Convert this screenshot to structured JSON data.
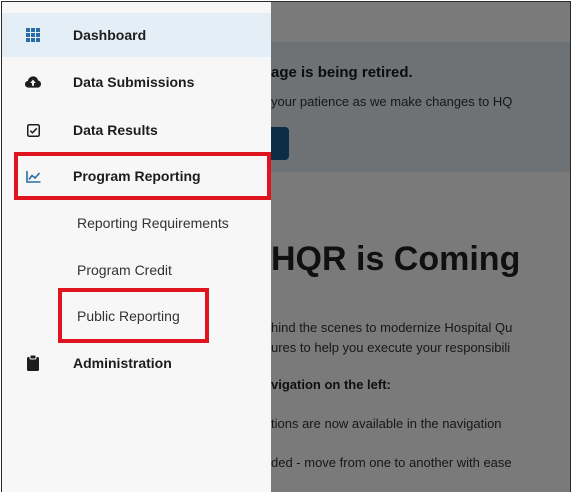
{
  "sidebar": {
    "items": [
      {
        "label": "Dashboard",
        "icon": "grid-icon"
      },
      {
        "label": "Data Submissions",
        "icon": "cloud-upload-icon"
      },
      {
        "label": "Data Results",
        "icon": "checkbox-icon"
      },
      {
        "label": "Program Reporting",
        "icon": "line-chart-icon"
      },
      {
        "label": "Administration",
        "icon": "clipboard-icon"
      }
    ],
    "sub_items": [
      {
        "label": "Reporting Requirements"
      },
      {
        "label": "Program Credit"
      },
      {
        "label": "Public Reporting"
      }
    ]
  },
  "main": {
    "banner": {
      "title": "age is being retired.",
      "text": "your patience as we make changes to HQ"
    },
    "hero_title": "HQR is Coming",
    "paragraphs": [
      "hind the scenes to modernize Hospital Qu",
      "ures to help you execute your responsibili",
      "vigation on the left:",
      "tions are now available in the navigation",
      "ded - move from one to another with ease"
    ]
  },
  "colors": {
    "accent": "#1c5e92",
    "highlight_box": "#e0141e",
    "active_bg": "#e4eef6",
    "icon_blue": "#2a6ca3"
  }
}
